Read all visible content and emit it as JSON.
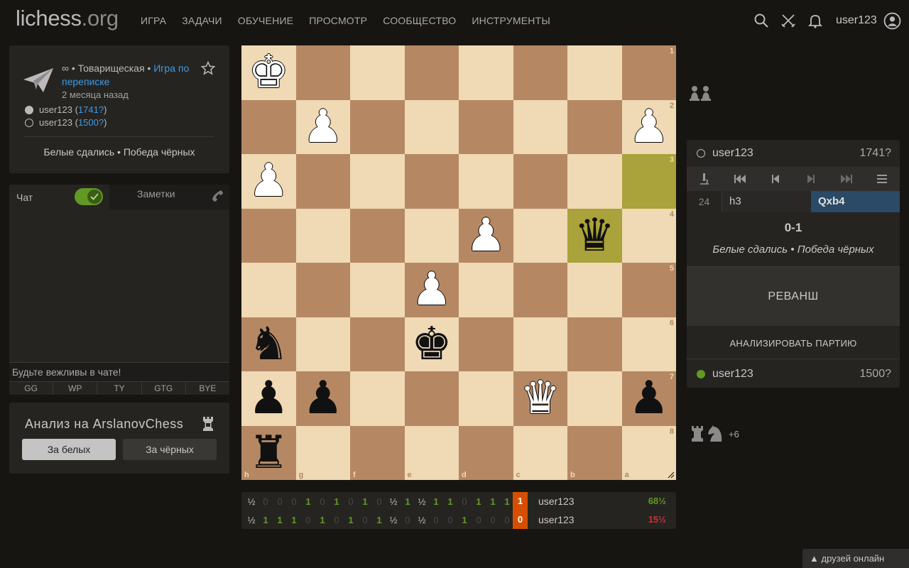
{
  "header": {
    "logo_main": "lichess",
    "logo_tld": ".org",
    "nav": [
      "ИГРА",
      "ЗАДАЧИ",
      "ОБУЧЕНИЕ",
      "ПРОСМОТР",
      "СООБЩЕСТВО",
      "ИНСТРУМЕНТЫ"
    ],
    "username": "user123",
    "icons": [
      "search-icon",
      "swords-icon",
      "bell-icon",
      "user-avatar-icon"
    ]
  },
  "game_info": {
    "time_control": "∞",
    "mode": "Товарищеская",
    "variant_link": "Игра по переписке",
    "date": "2 месяца назад",
    "white": {
      "name": "user123",
      "rating": "1741?"
    },
    "black": {
      "name": "user123",
      "rating": "1500?"
    },
    "result": "Белые сдались • Победа чёрных"
  },
  "chat": {
    "tab_chat": "Чат",
    "tab_notes": "Заметки",
    "placeholder": "Будьте вежливы в чате!",
    "quick": [
      "GG",
      "WP",
      "TY",
      "GTG",
      "BYE"
    ]
  },
  "analysis": {
    "title": "Анализ на ArslanovChess",
    "btn_white": "За белых",
    "btn_black": "За чёрных"
  },
  "board": {
    "orientation": "black",
    "files": [
      "h",
      "g",
      "f",
      "e",
      "d",
      "c",
      "b",
      "a"
    ],
    "ranks": [
      "1",
      "2",
      "3",
      "4",
      "5",
      "6",
      "7",
      "8"
    ],
    "highlight": [
      "b4",
      "a3"
    ],
    "pieces": [
      {
        "sq": "h1",
        "p": "K",
        "c": "w"
      },
      {
        "sq": "g2",
        "p": "P",
        "c": "w"
      },
      {
        "sq": "a2",
        "p": "P",
        "c": "w"
      },
      {
        "sq": "h3",
        "p": "P",
        "c": "w"
      },
      {
        "sq": "d4",
        "p": "P",
        "c": "w"
      },
      {
        "sq": "b4",
        "p": "Q",
        "c": "b"
      },
      {
        "sq": "e5",
        "p": "P",
        "c": "w"
      },
      {
        "sq": "h6",
        "p": "N",
        "c": "b"
      },
      {
        "sq": "e6",
        "p": "K",
        "c": "b"
      },
      {
        "sq": "h7",
        "p": "P",
        "c": "b"
      },
      {
        "sq": "g7",
        "p": "P",
        "c": "b"
      },
      {
        "sq": "c7",
        "p": "Q",
        "c": "w"
      },
      {
        "sq": "a7",
        "p": "P",
        "c": "b"
      },
      {
        "sq": "h8",
        "p": "R",
        "c": "b"
      }
    ]
  },
  "crosstable": {
    "row1": {
      "results": [
        "½",
        "0",
        "0",
        "0",
        "1",
        "0",
        "1",
        "0",
        "1",
        "0",
        "½",
        "1",
        "½",
        "1",
        "1",
        "0",
        "1",
        "1",
        "1"
      ],
      "current": "1",
      "name": "user123",
      "score": "68½",
      "score_color": "#629924"
    },
    "row2": {
      "results": [
        "½",
        "1",
        "1",
        "1",
        "0",
        "1",
        "0",
        "1",
        "0",
        "1",
        "½",
        "0",
        "½",
        "0",
        "0",
        "1",
        "0",
        "0",
        "0"
      ],
      "current": "0",
      "name": "user123",
      "score": "15½",
      "score_color": "#cc3333"
    }
  },
  "right": {
    "top_player": {
      "name": "user123",
      "rating": "1741?"
    },
    "bottom_player": {
      "name": "user123",
      "rating": "1500?"
    },
    "move_index": "24",
    "move_white": "h3",
    "move_black": "Qxb4",
    "score": "0-1",
    "result": "Белые сдались • Победа чёрных",
    "rematch": "РЕВАНШ",
    "analyse": "АНАЛИЗИРОВАТЬ ПАРТИЮ",
    "captured_bottom_plus": "+6"
  },
  "friends": "друзей онлайн"
}
